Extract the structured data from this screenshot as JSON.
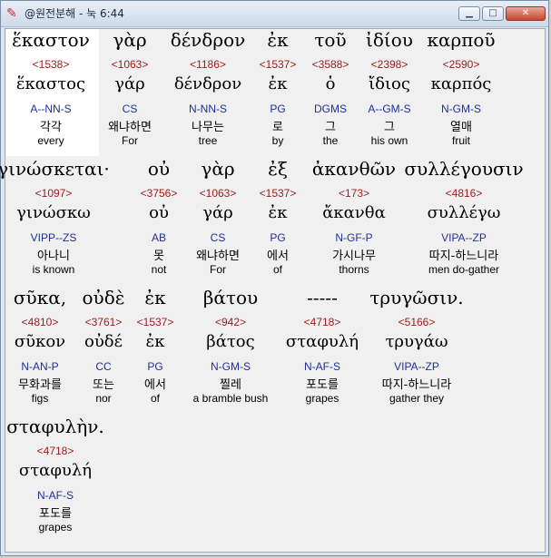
{
  "window": {
    "title": "@원전분해 - 눅 6:44",
    "app_icon": "book-icon",
    "minimize_label": "▁",
    "maximize_label": "□",
    "close_label": "✕"
  },
  "colors": {
    "strong_number": "#a01c1c",
    "morphology": "#1f2f9a",
    "highlight": "#ffffff"
  },
  "rows": [
    {
      "words": [
        {
          "greek": "ἕκαστον",
          "strong": "<1538>",
          "lemma": "ἕκαστος",
          "morph": "A--NN-S",
          "korean": "각각",
          "english": "every"
        },
        {
          "greek": "γὰρ",
          "strong": "<1063>",
          "lemma": "γάρ",
          "morph": "CS",
          "korean": "왜냐하면",
          "english": "For"
        },
        {
          "greek": "δένδρον",
          "strong": "<1186>",
          "lemma": "δένδρον",
          "morph": "N-NN-S",
          "korean": "나무는",
          "english": "tree"
        },
        {
          "greek": "ἐκ",
          "strong": "<1537>",
          "lemma": "ἐκ",
          "morph": "PG",
          "korean": "로",
          "english": "by"
        },
        {
          "greek": "τοῦ",
          "strong": "<3588>",
          "lemma": "ὁ",
          "morph": "DGMS",
          "korean": "그",
          "english": "the"
        },
        {
          "greek": "ἰδίου",
          "strong": "<2398>",
          "lemma": "ἴδιος",
          "morph": "A--GM-S",
          "korean": "그",
          "english": "his own"
        },
        {
          "greek": "καρποῦ",
          "strong": "<2590>",
          "lemma": "καρπός",
          "morph": "N-GM-S",
          "korean": "열매",
          "english": "fruit"
        }
      ]
    },
    {
      "words": [
        {
          "greek": "γινώσκεται·",
          "strong": "<1097>",
          "lemma": "γινώσκω",
          "morph": "VIPP--ZS",
          "korean": "아나니",
          "english": "is known"
        },
        {
          "greek": "οὐ",
          "strong": "<3756>",
          "lemma": "οὐ",
          "morph": "AB",
          "korean": "못",
          "english": "not"
        },
        {
          "greek": "γὰρ",
          "strong": "<1063>",
          "lemma": "γάρ",
          "morph": "CS",
          "korean": "왜냐하면",
          "english": "For"
        },
        {
          "greek": "ἐξ",
          "strong": "<1537>",
          "lemma": "ἐκ",
          "morph": "PG",
          "korean": "에서",
          "english": "of"
        },
        {
          "greek": "ἀκανθῶν",
          "strong": "<173>",
          "lemma": "ἄκανθα",
          "morph": "N-GF-P",
          "korean": "가시나무",
          "english": "thorns"
        },
        {
          "greek": "συλλέγουσιν",
          "strong": "<4816>",
          "lemma": "συλλέγω",
          "morph": "VIPA--ZP",
          "korean": "따지-하느니라",
          "english": "men do-gather"
        }
      ]
    },
    {
      "words": [
        {
          "greek": "σῦκα,",
          "strong": "<4810>",
          "lemma": "σῦκον",
          "morph": "N-AN-P",
          "korean": "무화과를",
          "english": "figs"
        },
        {
          "greek": "οὐδὲ",
          "strong": "<3761>",
          "lemma": "οὐδέ",
          "morph": "CC",
          "korean": "또는",
          "english": "nor"
        },
        {
          "greek": "ἐκ",
          "strong": "<1537>",
          "lemma": "ἐκ",
          "morph": "PG",
          "korean": "에서",
          "english": "of"
        },
        {
          "greek": "βάτου",
          "strong": "<942>",
          "lemma": "βάτος",
          "morph": "N-GM-S",
          "korean": "찔레",
          "english": "a bramble bush"
        },
        {
          "greek": "-----",
          "strong": "<4718>",
          "lemma": "σταφυλή",
          "morph": "N-AF-S",
          "korean": "포도를",
          "english": "grapes"
        },
        {
          "greek": "τρυγῶσιν.",
          "strong": "<5166>",
          "lemma": "τρυγάω",
          "morph": "VIPA--ZP",
          "korean": "따지-하느니라",
          "english": "gather they"
        }
      ]
    },
    {
      "words": [
        {
          "greek": "σταφυλὴν.",
          "strong": "<4718>",
          "lemma": "σταφυλή",
          "morph": "N-AF-S",
          "korean": "포도를",
          "english": "grapes"
        }
      ]
    }
  ]
}
